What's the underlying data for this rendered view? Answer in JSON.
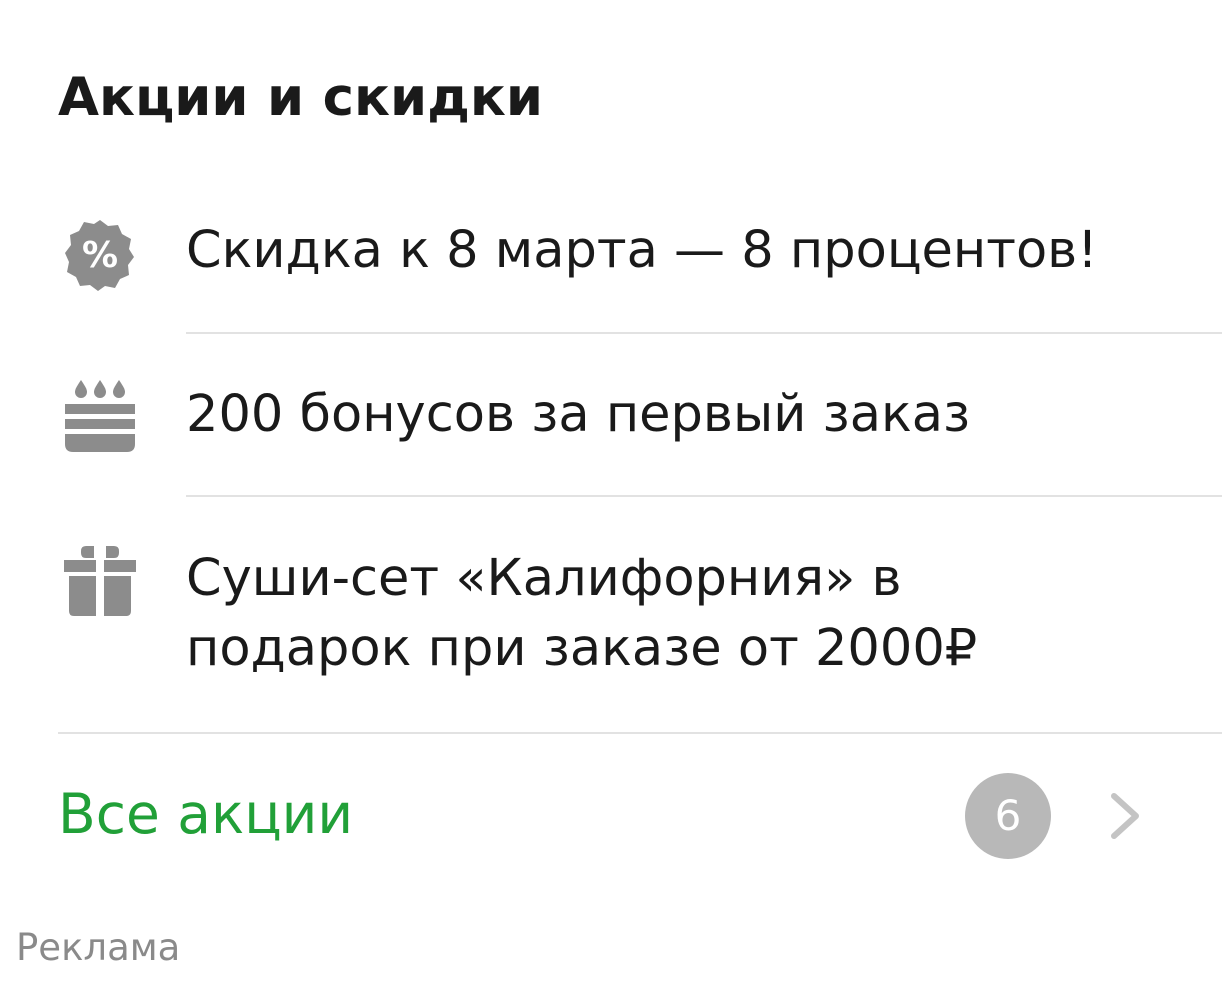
{
  "section": {
    "title": "Акции и скидки"
  },
  "promos": [
    {
      "icon": "percent-badge-icon",
      "lines": [
        "Скидка к 8 марта — 8 процентов!"
      ]
    },
    {
      "icon": "birthday-cake-icon",
      "lines": [
        "200 бонусов за первый заказ"
      ]
    },
    {
      "icon": "gift-icon",
      "lines": [
        "Суши-сет «Калифорния» в",
        "подарок при заказе от 2000₽"
      ]
    }
  ],
  "all_promos": {
    "label": "Все акции",
    "count": "6",
    "chevron_icon": "chevron-right-icon"
  },
  "ad_label": "Реклама",
  "colors": {
    "title_text": "#1a1a1a",
    "body_text": "#1a1a1a",
    "icon_gray": "#8c8c8c",
    "accent_green": "#21a038",
    "badge_gray": "#b8b8b8",
    "chevron_gray": "#c4c4c4",
    "divider": "#e2e2e2",
    "ad_text": "#8a8a8a"
  }
}
